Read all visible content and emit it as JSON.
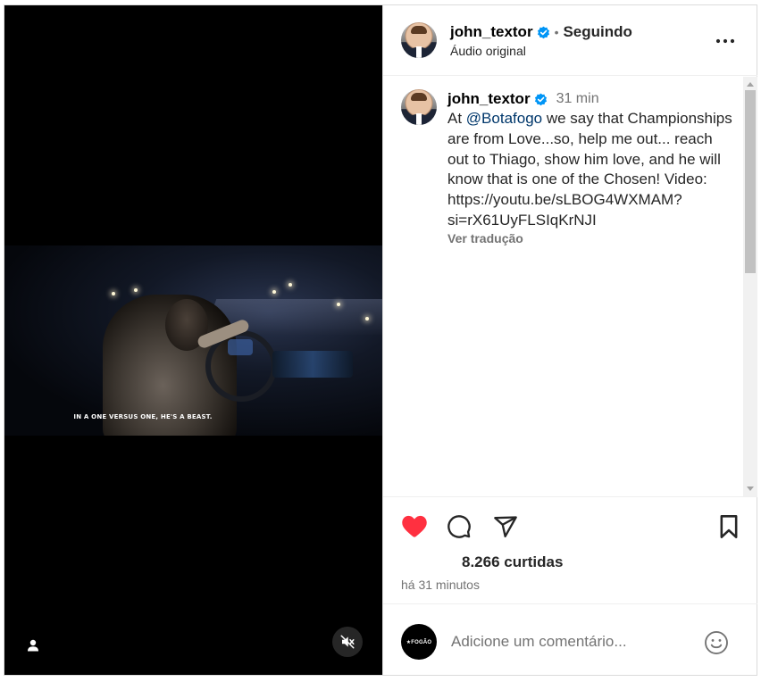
{
  "video": {
    "subtitle": "IN A ONE VERSUS ONE, HE'S A BEAST."
  },
  "header": {
    "username": "john_textor",
    "separator": "•",
    "follow_status": "Seguindo",
    "audio_label": "Áudio original"
  },
  "caption": {
    "username": "john_textor",
    "time": "31 min",
    "text_before_mention": "At ",
    "mention": "@Botafogo",
    "text_after_mention": " we say that Championships are from Love...so, help me out... reach out to Thiago, show him love, and he will know that is one of the Chosen! Video: https://youtu.be/sLBOG4WXMAM?si=rX61UyFLSIqKrNJI",
    "translate_label": "Ver tradução"
  },
  "actions": {
    "liked": true,
    "likes_label": "8.266 curtidas",
    "posted_time": "há 31 minutos"
  },
  "comment_bar": {
    "avatar_text": "★FOGÃO",
    "placeholder": "Adicione um comentário..."
  },
  "colors": {
    "like_red": "#ff3040",
    "verified_blue": "#0095f6",
    "mention_blue": "#00376b"
  },
  "icons": [
    "user-tag-icon",
    "mute-icon",
    "verified-icon",
    "more-icon",
    "heart-icon",
    "comment-icon",
    "share-icon",
    "bookmark-icon",
    "emoji-icon"
  ]
}
